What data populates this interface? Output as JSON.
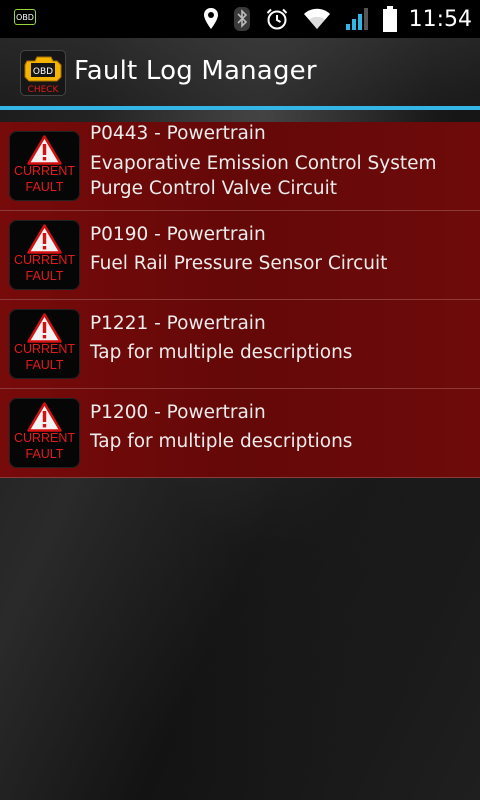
{
  "status_bar": {
    "notification_label": "OBD",
    "time": "11:54",
    "icons": [
      "location-icon",
      "bluetooth-icon",
      "alarm-icon",
      "wifi-icon",
      "signal-icon",
      "battery-icon"
    ]
  },
  "action_bar": {
    "app_icon_top": "OBD",
    "app_icon_bottom": "CHECK",
    "title": "Fault Log Manager",
    "accent_color": "#33b5e5"
  },
  "badge": {
    "line1": "CURRENT",
    "line2": "FAULT",
    "text_color": "#e31b1b"
  },
  "faults": [
    {
      "code_title": "P0443 - Powertrain",
      "description_lines": [
        "Evaporative Emission Control System",
        "Purge Control Valve Circuit"
      ]
    },
    {
      "code_title": "P0190 - Powertrain",
      "description_lines": [
        "Fuel Rail Pressure Sensor Circuit"
      ]
    },
    {
      "code_title": "P1221 - Powertrain",
      "description_lines": [
        "Tap for multiple descriptions"
      ]
    },
    {
      "code_title": "P1200 - Powertrain",
      "description_lines": [
        "Tap for multiple descriptions"
      ]
    }
  ]
}
